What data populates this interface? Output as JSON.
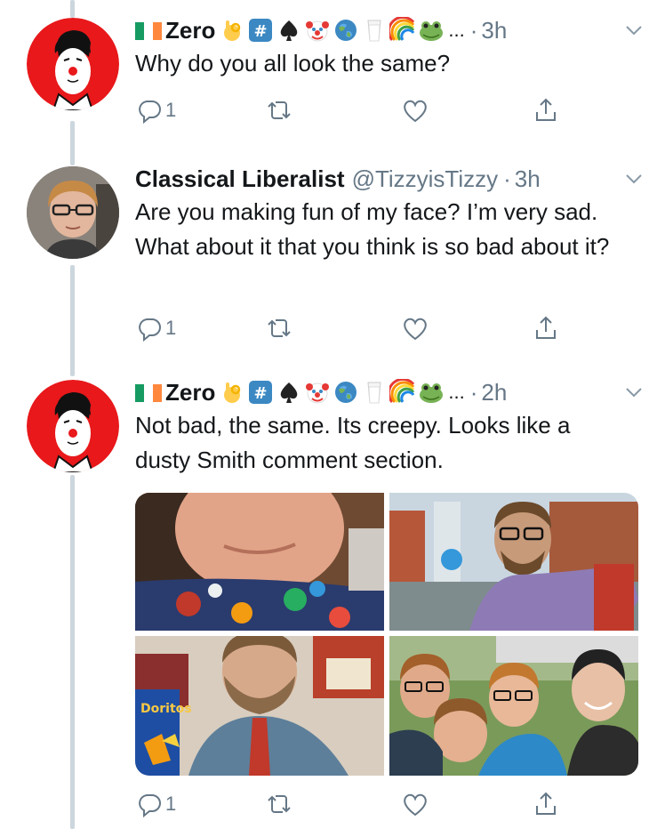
{
  "tweets": [
    {
      "display_name": "Zero",
      "handle": "",
      "ellipsis": "...",
      "time": "3h",
      "text": "Why do you all look the same?",
      "reply_count": "1",
      "emoji_names": [
        "ok-hand-emoji",
        "hashtag-emoji",
        "spade-emoji",
        "clown-emoji",
        "globe-emoji",
        "milk-emoji",
        "rainbow-emoji",
        "frog-emoji"
      ]
    },
    {
      "display_name": "Classical Liberalist",
      "handle": "@TizzyisTizzy",
      "ellipsis": "",
      "time": "3h",
      "text": "Are you making fun of my face? I’m very sad. What about it that you think is so bad about it?",
      "reply_count": "1",
      "emoji_names": []
    },
    {
      "display_name": "Zero",
      "handle": "",
      "ellipsis": "...",
      "time": "2h",
      "text": "Not bad, the same. Its creepy. Looks like a dusty Smith comment section.",
      "reply_count": "1",
      "emoji_names": [
        "ok-hand-emoji",
        "hashtag-emoji",
        "spade-emoji",
        "clown-emoji",
        "globe-emoji",
        "milk-emoji",
        "rainbow-emoji",
        "frog-emoji"
      ]
    }
  ],
  "separator": "·",
  "hashtag_symbol": "#",
  "media_photo_text": "Doritos",
  "colors": {
    "text": "#14171a",
    "secondary": "#657786",
    "thread_line": "#ccd6dd",
    "avatar_red": "#e8181b",
    "flag_green": "#169b62",
    "flag_orange": "#ff883e"
  }
}
